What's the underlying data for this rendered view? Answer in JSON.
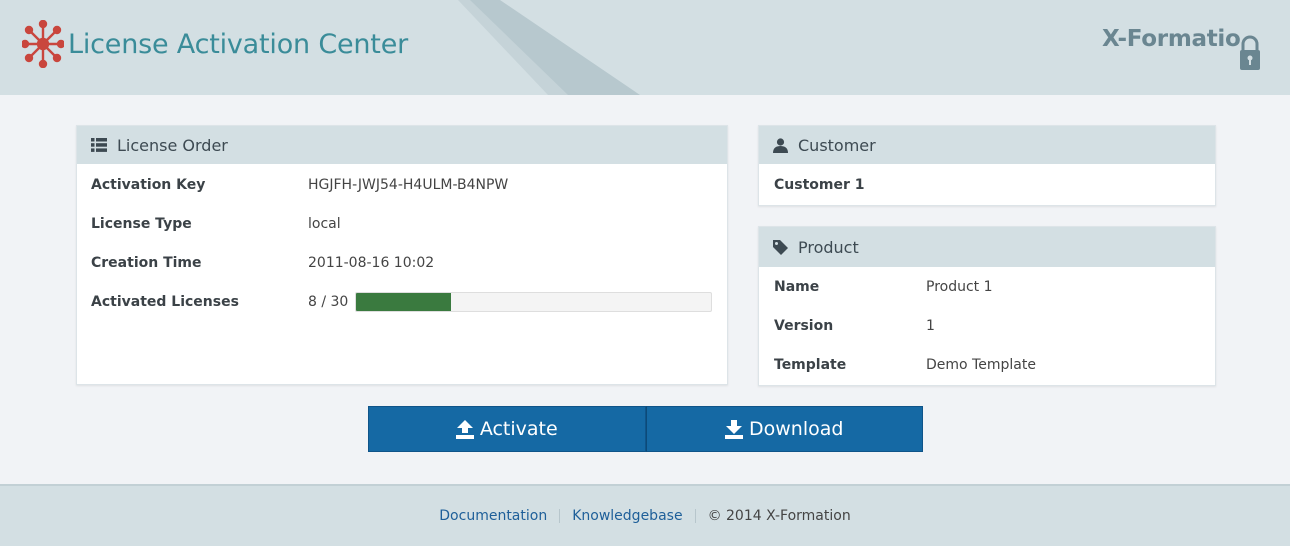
{
  "header": {
    "title": "License Activation Center",
    "brand": "X-Formatio"
  },
  "license_order": {
    "heading": "License Order",
    "rows": [
      {
        "label": "Activation Key",
        "value": "HGJFH-JWJ54-H4ULM-B4NPW"
      },
      {
        "label": "License Type",
        "value": "local"
      },
      {
        "label": "Creation Time",
        "value": "2011-08-16 10:02"
      },
      {
        "label": "Activated Licenses",
        "value": "8 / 30"
      }
    ],
    "progress_fraction": 0.2667,
    "progress_color": "#3a7a3f"
  },
  "customer": {
    "heading": "Customer",
    "name": "Customer 1"
  },
  "product": {
    "heading": "Product",
    "rows": [
      {
        "label": "Name",
        "value": "Product 1"
      },
      {
        "label": "Version",
        "value": "1"
      },
      {
        "label": "Template",
        "value": "Demo Template"
      }
    ]
  },
  "actions": {
    "activate_label": "Activate",
    "download_label": "Download",
    "button_color": "#1569a4"
  },
  "footer": {
    "documentation": "Documentation",
    "knowledgebase": "Knowledgebase",
    "copyright": "© 2014 X-Formation"
  },
  "colors": {
    "title": "#3a8c99",
    "header_bg": "#d3dfe3",
    "logo_red": "#c9463d"
  },
  "icons": {
    "logo": "network-node-icon",
    "license_order": "list-icon",
    "customer": "user-icon",
    "product": "tag-icon",
    "activate": "upload-icon",
    "download": "download-icon",
    "brand": "lock-icon"
  }
}
